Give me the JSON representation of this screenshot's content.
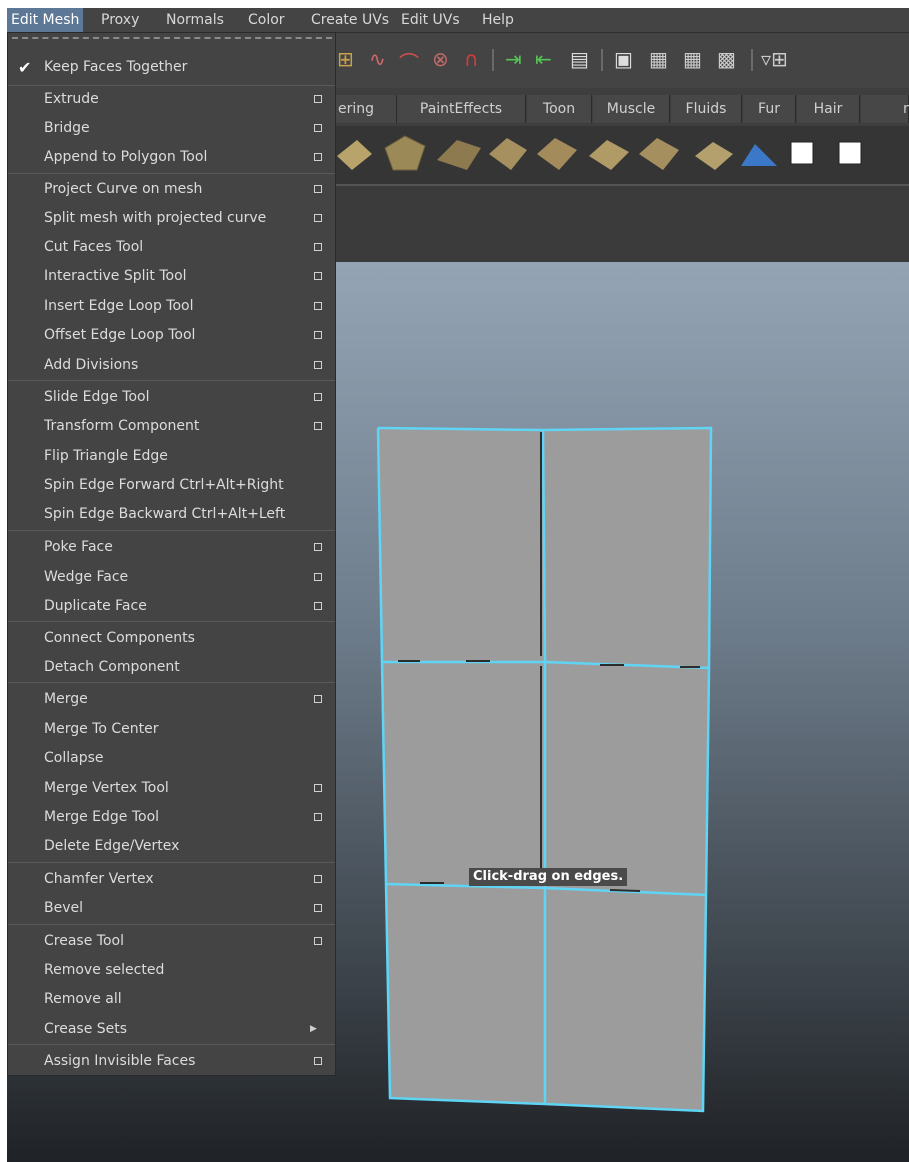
{
  "menubar": {
    "items": [
      "Edit Mesh",
      "Proxy",
      "Normals",
      "Color",
      "Create UVs",
      "Edit UVs",
      "Help"
    ]
  },
  "shelf": {
    "tabs": [
      "ering",
      "PaintEffects",
      "Toon",
      "Muscle",
      "Fluids",
      "Fur",
      "Hair",
      "n"
    ]
  },
  "edit_mesh_menu": {
    "keep_faces_together": "Keep Faces Together",
    "items": [
      "Extrude",
      "Bridge",
      "Append to Polygon Tool",
      "Project Curve on mesh",
      "Split mesh with projected curve",
      "Cut Faces Tool",
      "Interactive Split Tool",
      "Insert Edge Loop Tool",
      "Offset Edge Loop Tool",
      "Add Divisions",
      "Slide Edge Tool",
      "Transform Component",
      "Flip Triangle Edge",
      "Spin Edge Forward  Ctrl+Alt+Right",
      "Spin Edge Backward  Ctrl+Alt+Left",
      "Poke Face",
      "Wedge Face",
      "Duplicate Face",
      "Connect Components",
      "Detach Component",
      "Merge",
      "Merge To Center",
      "Collapse",
      "Merge Vertex Tool",
      "Merge Edge Tool",
      "Delete Edge/Vertex",
      "Chamfer Vertex",
      "Bevel",
      "Crease Tool",
      "Remove selected",
      "Remove all",
      "Crease Sets",
      "Assign Invisible Faces"
    ]
  },
  "viewport": {
    "tooltip": "Click-drag on edges."
  },
  "colors": {
    "menu_bg": "#444444",
    "active_menu": "#5d7896",
    "edge_highlight": "#5fd4f4",
    "face_gray": "#9c9c9c"
  }
}
